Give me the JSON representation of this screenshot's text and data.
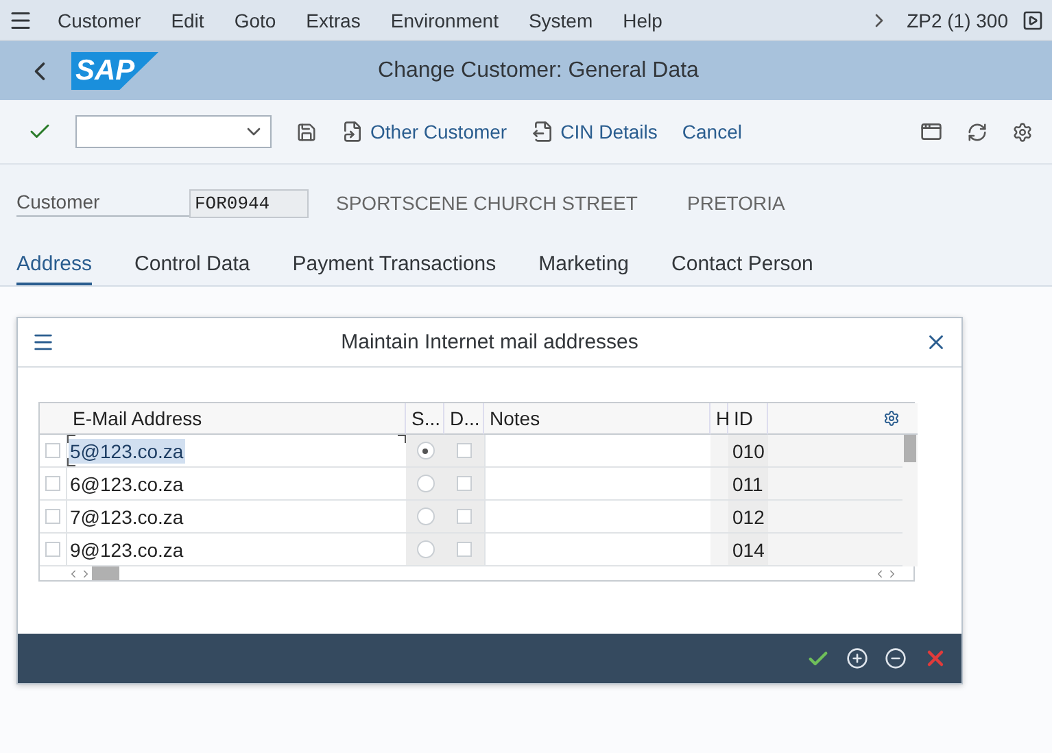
{
  "menu": [
    "Customer",
    "Edit",
    "Goto",
    "Extras",
    "Environment",
    "System",
    "Help"
  ],
  "system": "ZP2 (1) 300",
  "logo": "SAP",
  "title": "Change Customer: General Data",
  "toolbar": [
    {
      "kind": "command",
      "label": "Other Customer"
    },
    {
      "kind": "command",
      "label": "CIN Details"
    },
    {
      "kind": "text",
      "label": "Cancel"
    }
  ],
  "customer": {
    "label": "Customer",
    "value": "FOR0944",
    "name": "SPORTSCENE  CHURCH STREET",
    "city": "PRETORIA"
  },
  "tabs": [
    {
      "label": "Address",
      "selected": true
    },
    {
      "label": "Control Data",
      "selected": false
    },
    {
      "label": "Payment Transactions",
      "selected": false
    },
    {
      "label": "Marketing",
      "selected": false
    },
    {
      "label": "Contact Person",
      "selected": false
    }
  ],
  "dialog": {
    "title": "Maintain Internet mail addresses",
    "columns": [
      "E-Mail Address",
      "S...",
      "D...",
      "Notes",
      "H",
      "ID"
    ],
    "rows": [
      {
        "email": "5@123.co.za",
        "standard": true,
        "do_not_use": false,
        "id": "010",
        "selected": false,
        "focused": true
      },
      {
        "email": "6@123.co.za",
        "standard": false,
        "do_not_use": false,
        "id": "011",
        "selected": false,
        "focused": false
      },
      {
        "email": "7@123.co.za",
        "standard": false,
        "do_not_use": false,
        "id": "012",
        "selected": false,
        "focused": false
      },
      {
        "email": "9@123.co.za",
        "standard": false,
        "do_not_use": false,
        "id": "014",
        "selected": false,
        "focused": false
      }
    ]
  }
}
